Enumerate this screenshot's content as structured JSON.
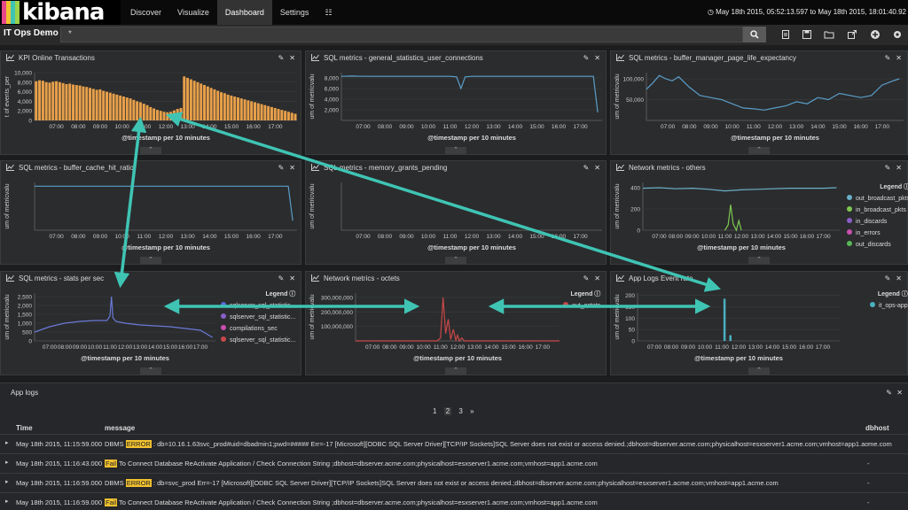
{
  "nav": {
    "logo_text": "kibana",
    "links": [
      "Discover",
      "Visualize",
      "Dashboard",
      "Settings",
      "☷"
    ],
    "active_index": 2,
    "time_range": "May 18th 2015, 05:52:13.597 to May 18th 2015, 18:01:40.92"
  },
  "subbar": {
    "dashboard_title": "IT Ops Demo",
    "query_value": "*",
    "tools": [
      "new-dashboard-icon",
      "save-icon",
      "open-icon",
      "share-icon",
      "add-panel-icon",
      "settings-icon"
    ]
  },
  "panels": {
    "kpi": {
      "title": "KPI Online Transactions",
      "ylabel": "t of events_per",
      "xlabel": "@timestamp per 10 minutes"
    },
    "user_conn": {
      "title": "SQL metrics - general_statistics_user_connections",
      "ylabel": "um of metricvalu",
      "xlabel": "@timestamp per 10 minutes"
    },
    "page_life": {
      "title": "SQL metrics - buffer_manager_page_life_expectancy",
      "ylabel": "um of metricvalu",
      "xlabel": "@timestamp per 10 minutes"
    },
    "cache_hit": {
      "title": "SQL metrics - buffer_cache_hit_ratio",
      "ylabel": "um of metricvalu",
      "xlabel": "@timestamp per 10 minutes"
    },
    "mem_grants": {
      "title": "SQL metrics - memory_grants_pending",
      "ylabel": "um of metricvalu",
      "xlabel": "@timestamp per 10 minutes"
    },
    "net_others": {
      "title": "Network metrics - others",
      "ylabel": "um of metricvalu",
      "xlabel": "@timestamp per 10 minutes",
      "legend_title": "Legend ⓘ",
      "legend": [
        {
          "label": "out_broadcast_pkts",
          "color": "#6ab0c8"
        },
        {
          "label": "in_broadcast_pkts",
          "color": "#7ec850"
        },
        {
          "label": "in_discards",
          "color": "#8a5ec8"
        },
        {
          "label": "in_errors",
          "color": "#c850b0"
        },
        {
          "label": "out_discards",
          "color": "#58b858"
        }
      ]
    },
    "stats": {
      "title": "SQL metrics - stats per sec",
      "ylabel": "um of metricvalu",
      "xlabel": "@timestamp per 10 minutes",
      "legend_title": "Legend ⓘ",
      "legend": [
        {
          "label": "sqlserver_sql_statistic...",
          "color": "#5a6ad8"
        },
        {
          "label": "sqlserver_sql_statistic...",
          "color": "#8a5ec8"
        },
        {
          "label": "compilations_sec",
          "color": "#c850b0"
        },
        {
          "label": "sqlserver_sql_statistic...",
          "color": "#c84848"
        }
      ]
    },
    "octets": {
      "title": "Network metrics - octets",
      "ylabel": "um of metricvalu",
      "xlabel": "@timestamp per 10 minutes",
      "legend_title": "Legend ⓘ",
      "legend": [
        {
          "label": "out_octets",
          "color": "#c84848"
        }
      ]
    },
    "applogs_rate": {
      "title": "App Logs Event rate",
      "ylabel": "um of metricvalu",
      "xlabel": "@timestamp per 10 minutes",
      "legend_title": "Legend ⓘ",
      "legend": [
        {
          "label": "it_ops-app",
          "color": "#4ab0c0"
        }
      ]
    }
  },
  "chart_data": [
    {
      "type": "bar",
      "id": "kpi",
      "color": "#e8a04a",
      "x_ticks": [
        "07:00",
        "08:00",
        "09:00",
        "10:00",
        "11:00",
        "12:00",
        "13:00",
        "14:00",
        "15:00",
        "16:00",
        "17:00"
      ],
      "y_ticks": [
        0,
        2000,
        4000,
        6000,
        8000,
        10000
      ],
      "y_tick_labels": [
        "0",
        "2,000",
        "4,000",
        "6,000",
        "8,000",
        "10,000"
      ],
      "ylim": [
        0,
        10000
      ],
      "x_range": [
        6.0,
        18.0
      ],
      "values": [
        8200,
        8400,
        8300,
        8000,
        7900,
        8100,
        8200,
        8000,
        7800,
        7600,
        7700,
        7500,
        7400,
        7300,
        7100,
        7000,
        6800,
        6600,
        6400,
        6500,
        6200,
        6000,
        5800,
        5600,
        5400,
        5200,
        5000,
        4800,
        4600,
        4300,
        4000,
        3800,
        3500,
        3200,
        2800,
        2500,
        2200,
        2000,
        1800,
        1700,
        1800,
        2100,
        2400,
        2600,
        9200,
        8900,
        8600,
        8300,
        8000,
        7700,
        7400,
        7100,
        6800,
        6500,
        6200,
        5900,
        5700,
        5400,
        5200,
        5000,
        4800,
        4600,
        4400,
        4200,
        4000,
        3800,
        3600,
        3400,
        3200,
        3000,
        2800,
        2600,
        2400,
        2200,
        2000,
        1800,
        1600,
        1400
      ]
    },
    {
      "type": "line",
      "id": "user_conn",
      "color": "#5a9ec8",
      "x_ticks": [
        "07:00",
        "08:00",
        "09:00",
        "10:00",
        "11:00",
        "12:00",
        "13:00",
        "14:00",
        "15:00",
        "16:00",
        "17:00"
      ],
      "y_ticks": [
        2000,
        4000,
        6000,
        8000
      ],
      "y_tick_labels": [
        "2,000",
        "4,000",
        "6,000",
        "8,000"
      ],
      "ylim": [
        0,
        9000
      ],
      "x_range": [
        6.0,
        18.0
      ],
      "x": [
        6.0,
        6.5,
        7.0,
        8.0,
        9.0,
        10.0,
        11.0,
        11.3,
        11.5,
        11.7,
        12.0,
        13.0,
        14.0,
        15.0,
        16.0,
        17.0,
        17.6,
        17.8
      ],
      "y": [
        8300,
        8350,
        8300,
        8300,
        8300,
        8300,
        8300,
        8200,
        6000,
        8200,
        8300,
        8300,
        8300,
        8300,
        8300,
        8300,
        8300,
        1500
      ]
    },
    {
      "type": "line",
      "id": "page_life",
      "color": "#5a9ec8",
      "x_ticks": [
        "07:00",
        "08:00",
        "09:00",
        "10:00",
        "11:00",
        "12:00",
        "13:00",
        "14:00",
        "15:00",
        "16:00",
        "17:00"
      ],
      "y_ticks": [
        50000,
        100000
      ],
      "y_tick_labels": [
        "50,000",
        "100,000"
      ],
      "ylim": [
        0,
        115000
      ],
      "x_range": [
        6.0,
        18.0
      ],
      "x": [
        6.0,
        6.3,
        6.6,
        6.9,
        7.2,
        7.5,
        8.0,
        8.5,
        9.0,
        9.5,
        10.0,
        10.5,
        11.0,
        11.5,
        12.0,
        12.5,
        13.0,
        13.5,
        14.0,
        14.5,
        15.0,
        15.5,
        16.0,
        16.5,
        17.0,
        17.5,
        17.8
      ],
      "y": [
        75000,
        90000,
        108000,
        100000,
        95000,
        105000,
        80000,
        60000,
        55000,
        50000,
        40000,
        30000,
        28000,
        25000,
        30000,
        35000,
        45000,
        40000,
        55000,
        50000,
        65000,
        60000,
        55000,
        60000,
        85000,
        95000,
        100000
      ]
    },
    {
      "type": "line",
      "id": "cache_hit",
      "color": "#5a9ec8",
      "x_ticks": [
        "07:00",
        "08:00",
        "09:00",
        "10:00",
        "11:00",
        "12:00",
        "13:00",
        "14:00",
        "15:00",
        "16:00",
        "17:00"
      ],
      "y_ticks": [],
      "y_tick_labels": [],
      "ylim": [
        0,
        100
      ],
      "x_range": [
        6.0,
        18.0
      ],
      "x": [
        6.0,
        7.0,
        9.0,
        11.0,
        13.0,
        15.0,
        17.0,
        17.6,
        17.8
      ],
      "y": [
        92,
        92,
        92,
        92,
        92,
        92,
        92,
        92,
        20
      ]
    },
    {
      "type": "line",
      "id": "mem_grants",
      "color": "#5a9ec8",
      "x_ticks": [
        "07:00",
        "08:00",
        "09:00",
        "10:00",
        "11:00",
        "12:00",
        "13:00",
        "14:00",
        "15:00",
        "16:00",
        "17:00"
      ],
      "y_ticks": [],
      "y_tick_labels": [],
      "ylim": [
        0,
        100
      ],
      "x_range": [
        6.0,
        18.0
      ],
      "x": [],
      "y": []
    },
    {
      "type": "line",
      "id": "net_others",
      "x_ticks": [
        "07:00",
        "08:00",
        "09:00",
        "10:00",
        "11:00",
        "12:00",
        "13:00",
        "14:00",
        "15:00",
        "16:00",
        "17:00"
      ],
      "y_ticks": [
        0,
        200,
        400
      ],
      "y_tick_labels": [
        "0",
        "200",
        "400"
      ],
      "ylim": [
        0,
        450
      ],
      "x_range": [
        6.0,
        18.0
      ],
      "series": [
        {
          "name": "out_broadcast_pkts",
          "color": "#6ab0c8",
          "x": [
            6.0,
            7.0,
            8.0,
            9.0,
            10.0,
            11.0,
            12.0,
            13.0,
            14.0,
            15.0,
            16.0,
            17.0,
            17.8
          ],
          "y": [
            395,
            400,
            390,
            395,
            385,
            370,
            380,
            385,
            390,
            395,
            395,
            395,
            400
          ]
        },
        {
          "name": "in_broadcast_pkts",
          "color": "#7ec850",
          "x": [
            11.0,
            11.2,
            11.35,
            11.5,
            11.7,
            11.85,
            12.0
          ],
          "y": [
            0,
            50,
            240,
            60,
            0,
            90,
            0
          ]
        }
      ]
    },
    {
      "type": "line",
      "id": "stats",
      "x_ticks": [
        "07:00",
        "08:00",
        "09:00",
        "10:00",
        "11:00",
        "12:00",
        "13:00",
        "14:00",
        "15:00",
        "16:00",
        "17:00"
      ],
      "y_ticks": [
        0,
        500,
        1000,
        1500,
        2000,
        2500
      ],
      "y_tick_labels": [
        "0",
        "500",
        "1,000",
        "1,500",
        "2,000",
        "2,500"
      ],
      "ylim": [
        0,
        2700
      ],
      "x_range": [
        6.0,
        18.0
      ],
      "series": [
        {
          "name": "sqlserver_sql_statistic...",
          "color": "#6a7ad8",
          "x": [
            6.0,
            7.0,
            8.0,
            9.0,
            10.0,
            10.8,
            11.0,
            11.1,
            11.2,
            11.4,
            12.0,
            13.0,
            14.0,
            15.0,
            16.0,
            17.0,
            17.8
          ],
          "y": [
            500,
            800,
            1000,
            1100,
            1150,
            1150,
            1400,
            2500,
            1300,
            1100,
            1000,
            900,
            850,
            800,
            700,
            600,
            200
          ]
        }
      ]
    },
    {
      "type": "line",
      "id": "octets",
      "x_ticks": [
        "07:00",
        "08:00",
        "09:00",
        "10:00",
        "11:00",
        "12:00",
        "13:00",
        "14:00",
        "15:00",
        "16:00",
        "17:00"
      ],
      "y_ticks": [
        100000000,
        200000000,
        300000000
      ],
      "y_tick_labels": [
        "100,000,000",
        "200,000,000",
        "300,000,000"
      ],
      "ylim": [
        0,
        330000000
      ],
      "x_range": [
        6.0,
        18.0
      ],
      "series": [
        {
          "name": "out_octets",
          "color": "#c84848",
          "x": [
            6.0,
            10.8,
            11.0,
            11.15,
            11.3,
            11.45,
            11.6,
            11.75,
            11.9,
            12.0,
            12.1,
            12.25,
            12.4,
            18.0
          ],
          "y": [
            0,
            0,
            20000000,
            300000000,
            50000000,
            150000000,
            10000000,
            80000000,
            5000000,
            40000000,
            0,
            20000000,
            0,
            0
          ]
        }
      ]
    },
    {
      "type": "bar",
      "id": "applogs_rate",
      "x_ticks": [
        "07:00",
        "08:00",
        "09:00",
        "10:00",
        "11:00",
        "12:00",
        "13:00",
        "14:00",
        "15:00",
        "16:00",
        "17:00"
      ],
      "y_ticks": [
        0,
        50,
        100,
        150,
        200
      ],
      "y_tick_labels": [
        "0",
        "50",
        "100",
        "150",
        "200"
      ],
      "ylim": [
        0,
        210
      ],
      "x_range": [
        6.0,
        18.0
      ],
      "series": [
        {
          "name": "it_ops-app",
          "color": "#4ab0c0",
          "x": [
            11.15,
            11.5
          ],
          "y": [
            185,
            25
          ]
        }
      ]
    }
  ],
  "logs": {
    "title": "App logs",
    "pages": [
      "1",
      "2",
      "3",
      "»"
    ],
    "current_page": "1",
    "columns": [
      "Time",
      "message",
      "dbhost"
    ],
    "rows": [
      {
        "time": "May 18th 2015, 11:15:59.000",
        "pre": "DBMS ",
        "hl": "ERROR",
        "post": " : db=10.16.1.63svc_prod#uid=dbadmin1;pwd=##### Err=-17 [Microsoft][ODBC SQL Server Driver][TCP/IP Sockets]SQL Server does not exist or access denied.;dbhost=dbserver.acme.com;physicalhost=esxserver1.acme.com;vmhost=app1.acme.com",
        "dbhost": "-"
      },
      {
        "time": "May 18th 2015, 11:16:43.000",
        "pre": "",
        "hl": "Fail",
        "post": " To Connect Database  ReActivate Application / Check Connection String ;dbhost=dbserver.acme.com;physicalhost=esxserver1.acme.com;vmhost=app1.acme.com",
        "dbhost": "-"
      },
      {
        "time": "May 18th 2015, 11:16:59.000",
        "pre": "DBMS ",
        "hl": "ERROR",
        "post": " : db=svc_prod Err=-17 [Microsoft][ODBC SQL Server Driver][TCP/IP Sockets]SQL Server does not exist or access denied.;dbhost=dbserver.acme.com;physicalhost=esxserver1.acme.com;vmhost=app1.acme.com",
        "dbhost": "-"
      },
      {
        "time": "May 18th 2015, 11:16:59.000",
        "pre": "",
        "hl": "Fail",
        "post": " To Connect Database  ReActivate Application / Check Connection String ;dbhost=dbserver.acme.com;physicalhost=esxserver1.acme.com;vmhost=app1.acme.com",
        "dbhost": "-"
      }
    ]
  },
  "colors": {
    "annotation_arrow": "#3fc4b4",
    "logo_bars": [
      "#e8488a",
      "#f2c230",
      "#3fc4b4",
      "#9bd14b"
    ]
  }
}
